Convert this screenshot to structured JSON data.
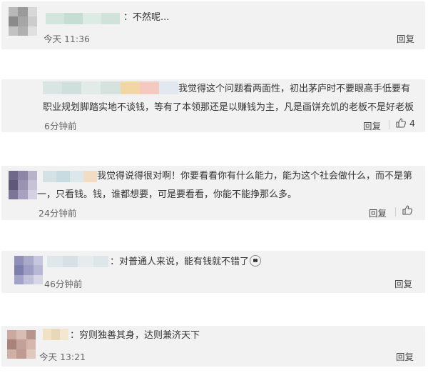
{
  "comments": [
    {
      "text": "：不然呢...",
      "time": "今天 11:36",
      "reply_label": "回复",
      "avatar_colors": [
        "#b8b8b8",
        "#9a9a9a",
        "#d8d8d8",
        "#8a8a8a",
        "#a6a6a6",
        "#cccccc",
        "#c2c2c2",
        "#b0b0b0",
        "#e0e0e0"
      ],
      "name_colors": [
        "#d2e6dd",
        "#c6ddd3",
        "#dcebe4",
        "#cfe3da"
      ]
    },
    {
      "text": "我觉得这个问题看两面性，初出茅庐时不要眼高手低要有职业规划脚踏实地不谈钱，等有了本领那还是以赚钱为主，凡是画饼充饥的老板不是好老板",
      "time": "6分钟前",
      "reply_label": "回复",
      "like_count": "4",
      "avatar_colors": [],
      "name_colors": [
        "#d9e5e2",
        "#cfe0dc",
        "#e3ebe9",
        "#d5e2de",
        "#f2d6a4",
        "#f4c9c0",
        "#e2e8f0"
      ]
    },
    {
      "text": "我觉得说得很对啊！你要看看你有什么能力，能为这个社会做什么，而不是第一，只看钱。钱，谁都想要，可是要看看，你能不能挣那么多。",
      "time": "24分钟前",
      "reply_label": "回复",
      "like_label": "",
      "avatar_colors": [
        "#6f6a8a",
        "#8d86a6",
        "#b9b3c9",
        "#5f5878",
        "#9a93b2",
        "#c8c2d6",
        "#7c7598",
        "#a8a1c0",
        "#d6d0e3"
      ],
      "name_colors": [
        "#d4e2e6",
        "#c8dbe0",
        "#dbe7ea",
        "#f3dcc4"
      ]
    },
    {
      "text": "：对普通人来说，能有钱就不错了",
      "time": "46分钟前",
      "reply_label": "回复",
      "avatar_colors": [
        "#8f8fb8",
        "#a9a9c9",
        "#c6c6dc",
        "#7f7fae",
        "#9e9ec4",
        "#b8b8d4",
        "#a3a3c7",
        "#c0c0da",
        "#d6d6e6"
      ],
      "name_colors": [
        "#dfe7ea",
        "#d6e1e5",
        "#e6ecee",
        "#dde6e9"
      ]
    },
    {
      "text": "：穷则独善其身，达则兼济天下",
      "time": "今天 13:21",
      "reply_label": "回复",
      "avatar_colors": [
        "#c9a9a0",
        "#d9bdb5",
        "#b8958c",
        "#a98279",
        "#c4a198",
        "#d5b7ae",
        "#cfb0a7",
        "#be9a91",
        "#e0c8c1"
      ],
      "name_colors": [
        "#f1e2c6",
        "#e9d8b8",
        "#f3e7d0"
      ]
    }
  ]
}
